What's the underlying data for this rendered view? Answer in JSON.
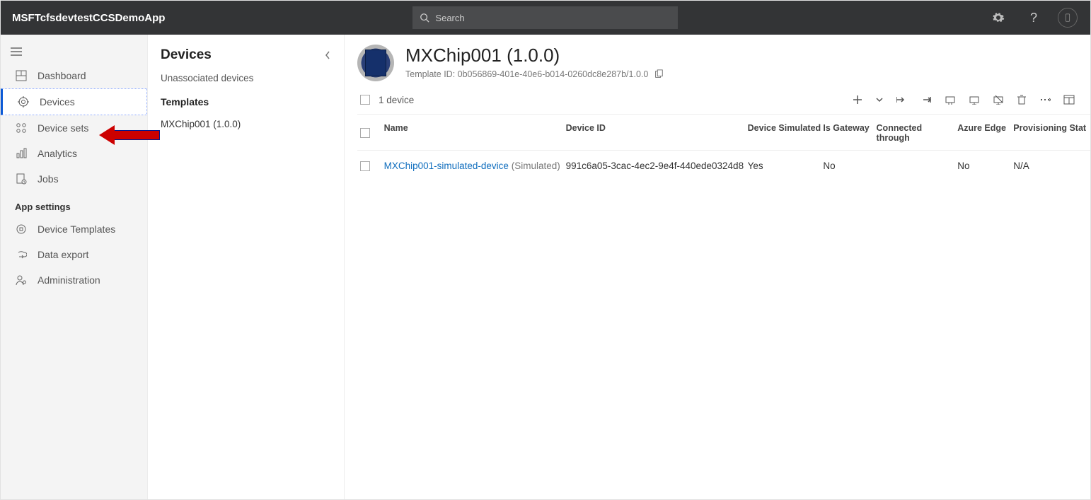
{
  "header": {
    "app_title": "MSFTcfsdevtestCCSDemoApp",
    "search_placeholder": "Search"
  },
  "nav": {
    "items": {
      "dashboard": "Dashboard",
      "devices": "Devices",
      "device_sets": "Device sets",
      "analytics": "Analytics",
      "jobs": "Jobs"
    },
    "section_app_settings": "App settings",
    "settings_items": {
      "device_templates": "Device Templates",
      "data_export": "Data export",
      "administration": "Administration"
    }
  },
  "sec_panel": {
    "title": "Devices",
    "unassociated": "Unassociated devices",
    "templates_header": "Templates",
    "template_item": "MXChip001 (1.0.0)"
  },
  "main": {
    "title": "MXChip001 (1.0.0)",
    "template_id_label": "Template ID: 0b056869-401e-40e6-b014-0260dc8e287b/1.0.0",
    "device_count": "1 device",
    "columns": {
      "name": "Name",
      "device_id": "Device ID",
      "simulated": "Device Simulated",
      "gateway": "Is Gateway",
      "connected": "Connected through",
      "edge": "Azure Edge",
      "provisioning": "Provisioning Stat"
    },
    "row": {
      "name": "MXChip001-simulated-device",
      "sim_tag": "(Simulated)",
      "device_id": "991c6a05-3cac-4ec2-9e4f-440ede0324d8",
      "simulated": "Yes",
      "gateway": "No",
      "connected": "",
      "edge": "No",
      "provisioning": "N/A"
    }
  }
}
